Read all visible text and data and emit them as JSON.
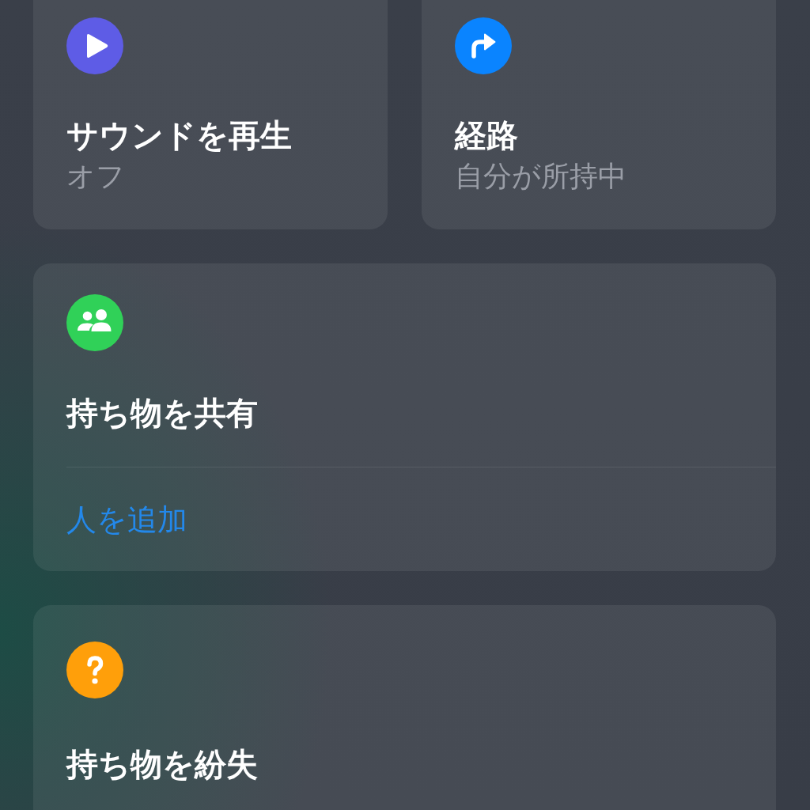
{
  "tiles": [
    {
      "kind": "play",
      "color": "#5e5ce6",
      "title": "サウンドを再生",
      "subtitle": "オフ"
    },
    {
      "kind": "directions",
      "color": "#0a84ff",
      "title": "経路",
      "subtitle": "自分が所持中"
    }
  ],
  "cards": [
    {
      "kind": "people",
      "color": "#30d158",
      "title": "持ち物を共有",
      "action": "人を追加"
    },
    {
      "kind": "question",
      "color": "#ff9f0a",
      "title": "持ち物を紛失"
    }
  ]
}
